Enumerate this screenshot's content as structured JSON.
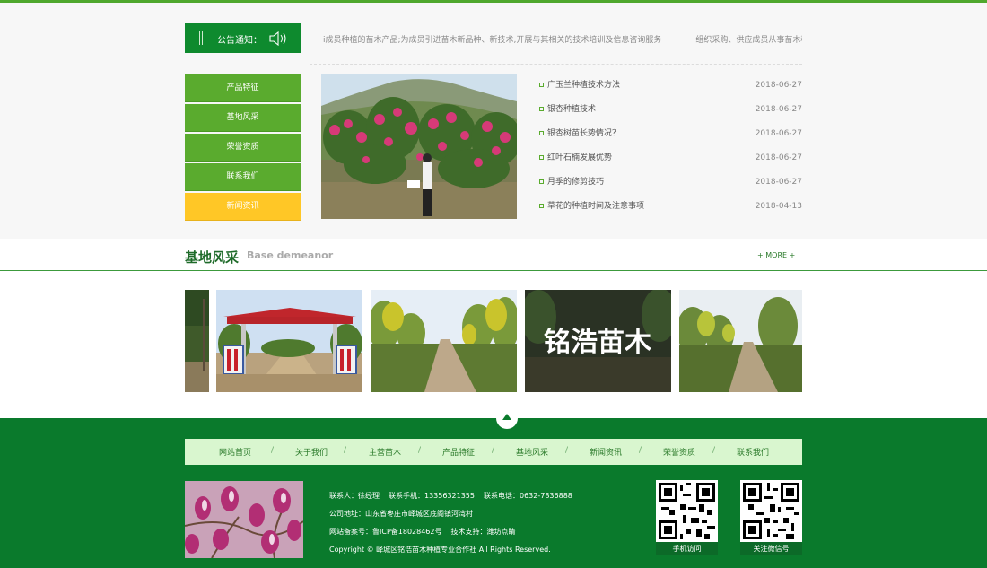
{
  "notice": {
    "label": "公告通知：",
    "items": [
      "i成员种植的苗木产品;为成员引进苗木新品种、新技术,开展与其相关的技术培训及信息咨询服务",
      "组织采购、供应成员从事苗木种植所需i"
    ]
  },
  "side_nav": {
    "items": [
      {
        "label": "产品特征",
        "active": false
      },
      {
        "label": "基地风采",
        "active": false
      },
      {
        "label": "荣誉资质",
        "active": false
      },
      {
        "label": "联系我们",
        "active": false
      },
      {
        "label": "新闻资讯",
        "active": true
      }
    ]
  },
  "news": [
    {
      "title": "广玉兰种植技术方法",
      "date": "2018-06-27"
    },
    {
      "title": "银杏种植技术",
      "date": "2018-06-27"
    },
    {
      "title": "银杏树苗长势情况？",
      "date": "2018-06-27"
    },
    {
      "title": "红叶石楠发展优势",
      "date": "2018-06-27"
    },
    {
      "title": "月季的修剪技巧",
      "date": "2018-06-27"
    },
    {
      "title": "草花的种植时间及注意事项",
      "date": "2018-04-13"
    }
  ],
  "base": {
    "title": "基地风采",
    "subtitle": "Base demeanor",
    "more": "+ MORE +",
    "gate_sign_left": "铭浩苗木种植基地",
    "gate_sign_right": "银杏种植基地",
    "brand_banner": "铭浩苗木"
  },
  "footer": {
    "nav": [
      "网站首页",
      "关于我们",
      "主营苗木",
      "产品特征",
      "基地风采",
      "新闻资讯",
      "荣誉资质",
      "联系我们"
    ],
    "separator": "/",
    "contact_person": "联系人：徐经理",
    "mobile": "联系手机：13356321355",
    "phone": "联系电话：0632-7836888",
    "address": "公司地址：山东省枣庄市峄城区底阁镇河湾村",
    "icp": "网站备案号：鲁ICP备18028462号",
    "support": "技术支持：潍坊点睛",
    "copyright": "Copyright © 峄城区铭浩苗木种植专业合作社 All Rights Reserved.",
    "qr_mobile": "手机访问",
    "qr_wechat": "关注微信号"
  },
  "colors": {
    "brand_green": "#0a7a2c",
    "nav_green": "#5aab2e",
    "active_yellow": "#ffc726"
  }
}
